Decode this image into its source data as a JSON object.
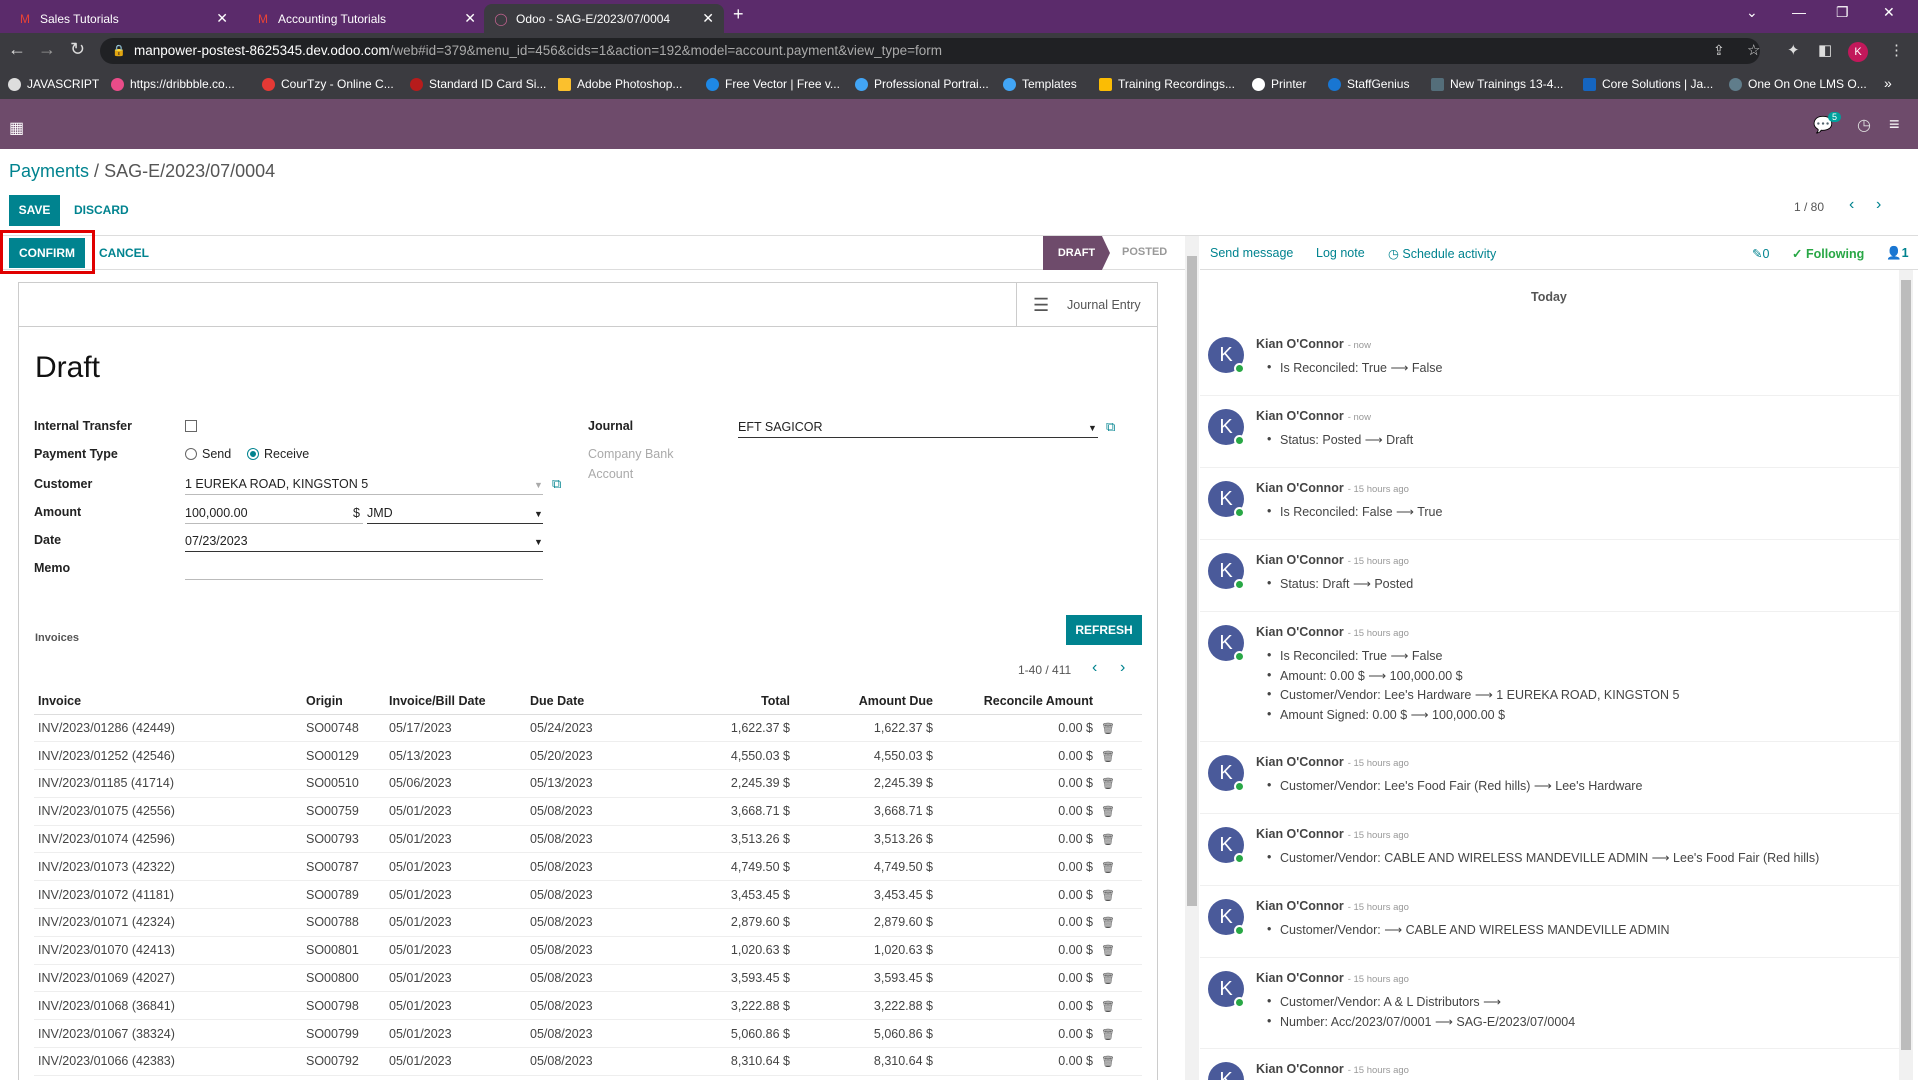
{
  "browser": {
    "tabs": [
      {
        "label": "Sales Tutorials"
      },
      {
        "label": "Accounting Tutorials"
      },
      {
        "label": "Odoo - SAG-E/2023/07/0004"
      }
    ],
    "url_host": "manpower-postest-8625345.dev.odoo.com",
    "url_rest": "/web#id=379&menu_id=456&cids=1&action=192&model=account.payment&view_type=form",
    "profile_initial": "K",
    "bookmarks": [
      "JAVASCRIPT",
      "https://dribbble.co...",
      "CourTzy - Online C...",
      "Standard ID Card Si...",
      "Adobe Photoshop...",
      "Free Vector | Free v...",
      "Professional Portrai...",
      "Templates",
      "Training Recordings...",
      "Printer",
      "StaffGenius",
      "New Trainings 13-4...",
      "Core Solutions | Ja...",
      "One On One LMS O..."
    ]
  },
  "navbar": {
    "chat_badge": "5"
  },
  "breadcrumb": {
    "parent": "Payments",
    "separator": " / ",
    "current": "SAG-E/2023/07/0004"
  },
  "toolbar": {
    "save": "SAVE",
    "discard": "DISCARD",
    "pager": "1 / 80"
  },
  "status": {
    "confirm": "CONFIRM",
    "cancel": "CANCEL",
    "stage_draft": "DRAFT",
    "stage_posted": "POSTED"
  },
  "form": {
    "journal_entry": "Journal Entry",
    "title": "Draft",
    "labels": {
      "internal_transfer": "Internal Transfer",
      "payment_type": "Payment Type",
      "customer": "Customer",
      "amount": "Amount",
      "date": "Date",
      "memo": "Memo",
      "journal": "Journal",
      "company_bank": "Company Bank",
      "company_bank2": "Account"
    },
    "payment_type_send": "Send",
    "payment_type_receive": "Receive",
    "customer": "1 EUREKA ROAD, KINGSTON 5",
    "amount": "100,000.00",
    "currency_symbol": "$",
    "currency": "JMD",
    "date": "07/23/2023",
    "journal": "EFT SAGICOR",
    "invoices_label": "Invoices",
    "refresh": "REFRESH",
    "table_pager": "1-40 / 411"
  },
  "invoices": {
    "headers": [
      "Invoice",
      "Origin",
      "Invoice/Bill Date",
      "Due Date",
      "Total",
      "Amount Due",
      "Reconcile Amount"
    ],
    "rows": [
      [
        "INV/2023/01286 (42449)",
        "SO00748",
        "05/17/2023",
        "05/24/2023",
        "1,622.37 $",
        "1,622.37 $",
        "0.00 $"
      ],
      [
        "INV/2023/01252 (42546)",
        "SO00129",
        "05/13/2023",
        "05/20/2023",
        "4,550.03 $",
        "4,550.03 $",
        "0.00 $"
      ],
      [
        "INV/2023/01185 (41714)",
        "SO00510",
        "05/06/2023",
        "05/13/2023",
        "2,245.39 $",
        "2,245.39 $",
        "0.00 $"
      ],
      [
        "INV/2023/01075 (42556)",
        "SO00759",
        "05/01/2023",
        "05/08/2023",
        "3,668.71 $",
        "3,668.71 $",
        "0.00 $"
      ],
      [
        "INV/2023/01074 (42596)",
        "SO00793",
        "05/01/2023",
        "05/08/2023",
        "3,513.26 $",
        "3,513.26 $",
        "0.00 $"
      ],
      [
        "INV/2023/01073 (42322)",
        "SO00787",
        "05/01/2023",
        "05/08/2023",
        "4,749.50 $",
        "4,749.50 $",
        "0.00 $"
      ],
      [
        "INV/2023/01072 (41181)",
        "SO00789",
        "05/01/2023",
        "05/08/2023",
        "3,453.45 $",
        "3,453.45 $",
        "0.00 $"
      ],
      [
        "INV/2023/01071 (42324)",
        "SO00788",
        "05/01/2023",
        "05/08/2023",
        "2,879.60 $",
        "2,879.60 $",
        "0.00 $"
      ],
      [
        "INV/2023/01070 (42413)",
        "SO00801",
        "05/01/2023",
        "05/08/2023",
        "1,020.63 $",
        "1,020.63 $",
        "0.00 $"
      ],
      [
        "INV/2023/01069 (42027)",
        "SO00800",
        "05/01/2023",
        "05/08/2023",
        "3,593.45 $",
        "3,593.45 $",
        "0.00 $"
      ],
      [
        "INV/2023/01068 (36841)",
        "SO00798",
        "05/01/2023",
        "05/08/2023",
        "3,222.88 $",
        "3,222.88 $",
        "0.00 $"
      ],
      [
        "INV/2023/01067 (38324)",
        "SO00799",
        "05/01/2023",
        "05/08/2023",
        "5,060.86 $",
        "5,060.86 $",
        "0.00 $"
      ],
      [
        "INV/2023/01066 (42383)",
        "SO00792",
        "05/01/2023",
        "05/08/2023",
        "8,310.64 $",
        "8,310.64 $",
        "0.00 $"
      ]
    ]
  },
  "chatter": {
    "send_message": "Send message",
    "log_note": "Log note",
    "schedule_activity": "Schedule activity",
    "attachments": "0",
    "following": "Following",
    "followers": "1",
    "today": "Today",
    "messages": [
      {
        "author": "Kian O'Connor",
        "ago": "- now",
        "changes": [
          "Is Reconciled: True ⟶ False"
        ]
      },
      {
        "author": "Kian O'Connor",
        "ago": "- now",
        "changes": [
          "Status: Posted ⟶ Draft"
        ]
      },
      {
        "author": "Kian O'Connor",
        "ago": "- 15 hours ago",
        "changes": [
          "Is Reconciled: False ⟶ True"
        ]
      },
      {
        "author": "Kian O'Connor",
        "ago": "- 15 hours ago",
        "changes": [
          "Status: Draft ⟶ Posted"
        ]
      },
      {
        "author": "Kian O'Connor",
        "ago": "- 15 hours ago",
        "changes": [
          "Is Reconciled: True ⟶ False",
          "Amount: 0.00 $ ⟶ 100,000.00 $",
          "Customer/Vendor: Lee's Hardware ⟶ 1 EUREKA ROAD, KINGSTON 5",
          "Amount Signed: 0.00 $ ⟶ 100,000.00 $"
        ]
      },
      {
        "author": "Kian O'Connor",
        "ago": "- 15 hours ago",
        "changes": [
          "Customer/Vendor: Lee's Food Fair (Red hills) ⟶ Lee's Hardware"
        ]
      },
      {
        "author": "Kian O'Connor",
        "ago": "- 15 hours ago",
        "changes": [
          "Customer/Vendor: CABLE AND WIRELESS MANDEVILLE ADMIN ⟶ Lee's Food Fair (Red hills)"
        ]
      },
      {
        "author": "Kian O'Connor",
        "ago": "- 15 hours ago",
        "changes": [
          "Customer/Vendor: ⟶ CABLE AND WIRELESS MANDEVILLE ADMIN"
        ]
      },
      {
        "author": "Kian O'Connor",
        "ago": "- 15 hours ago",
        "changes": [
          "Customer/Vendor: A & L Distributors ⟶",
          "Number: Acc/2023/07/0001 ⟶ SAG-E/2023/07/0004"
        ]
      },
      {
        "author": "Kian O'Connor",
        "ago": "- 15 hours ago",
        "changes": []
      }
    ]
  }
}
